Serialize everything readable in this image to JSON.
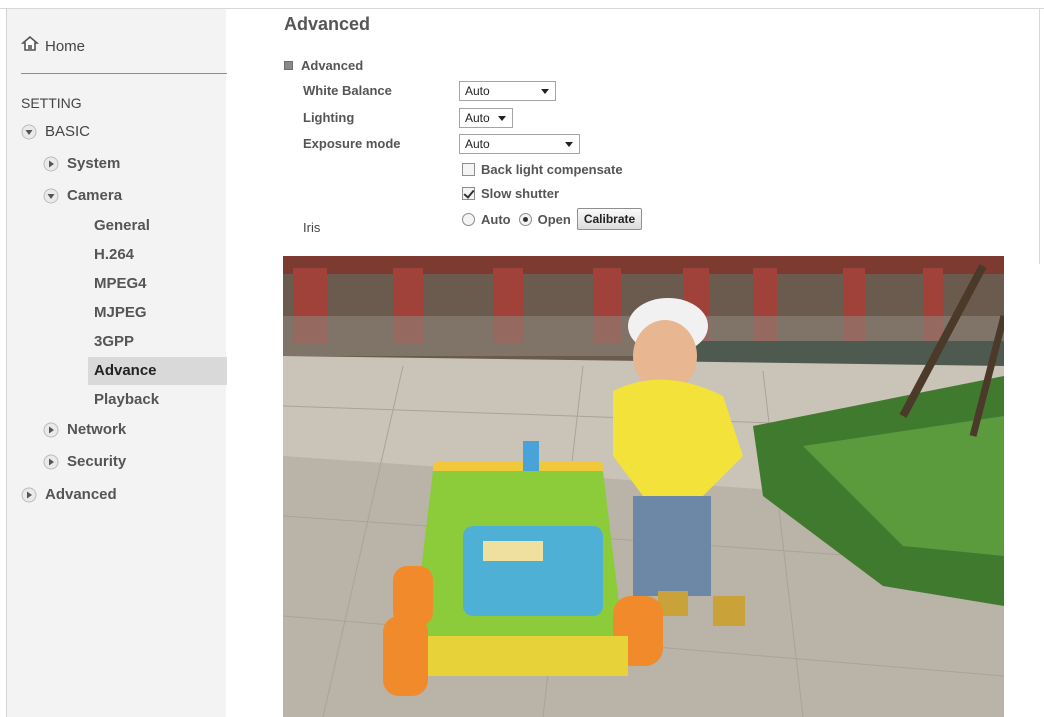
{
  "sidebar": {
    "home_label": "Home",
    "setting_label": "SETTING",
    "basic_label": "BASIC",
    "system_label": "System",
    "camera_label": "Camera",
    "camera_items": [
      "General",
      "H.264",
      "MPEG4",
      "MJPEG",
      "3GPP",
      "Advance",
      "Playback"
    ],
    "active_item": "Advance",
    "network_label": "Network",
    "security_label": "Security",
    "advanced_label": "Advanced"
  },
  "main": {
    "title": "Advanced",
    "section_label": "Advanced",
    "white_balance": {
      "label": "White Balance",
      "value": "Auto"
    },
    "lighting": {
      "label": "Lighting",
      "value": "Auto"
    },
    "exposure_mode": {
      "label": "Exposure mode",
      "value": "Auto"
    },
    "back_light": {
      "label": "Back light compensate",
      "checked": false
    },
    "slow_shutter": {
      "label": "Slow shutter",
      "checked": true
    },
    "iris": {
      "label": "Iris",
      "options": [
        "Auto",
        "Open"
      ],
      "selected": "Open",
      "calibrate_label": "Calibrate"
    }
  },
  "colors": {
    "sidebar_bg": "#f3f3f3",
    "active_bg": "#d9d9d9",
    "text": "#555555"
  }
}
